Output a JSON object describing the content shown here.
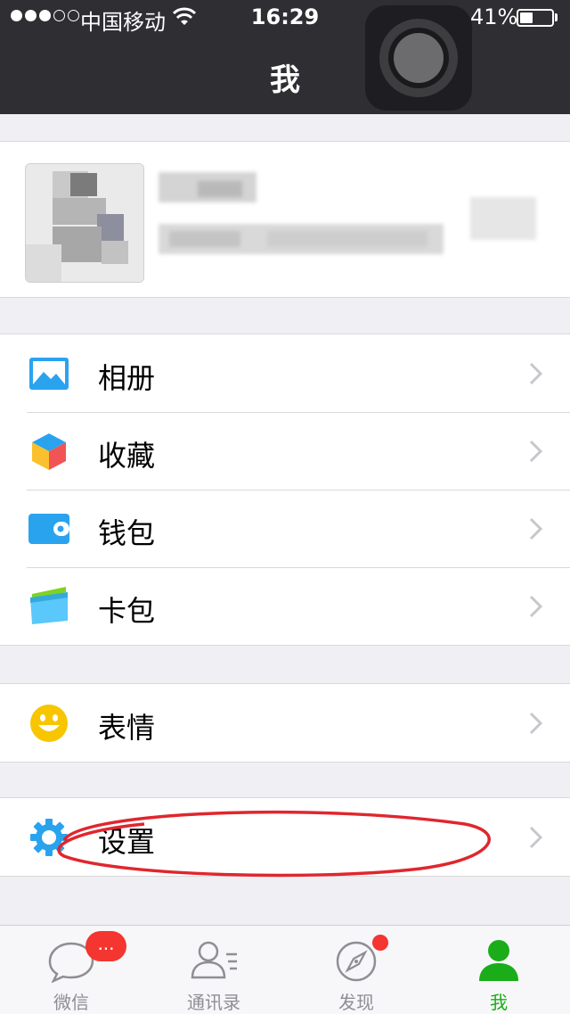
{
  "status_bar": {
    "carrier": "中国移动",
    "time": "16:29",
    "battery_percent": "41%",
    "battery_level": 0.41,
    "signal_bars_filled": 3,
    "signal_bars_total": 5
  },
  "nav": {
    "title": "我"
  },
  "menu_groups": [
    {
      "items": [
        {
          "label": "相册",
          "icon": "album-icon"
        },
        {
          "label": "收藏",
          "icon": "favorites-icon"
        },
        {
          "label": "钱包",
          "icon": "wallet-icon"
        },
        {
          "label": "卡包",
          "icon": "card-package-icon"
        }
      ]
    },
    {
      "items": [
        {
          "label": "表情",
          "icon": "sticker-smile-icon"
        }
      ]
    },
    {
      "items": [
        {
          "label": "设置",
          "icon": "settings-gear-icon"
        }
      ]
    }
  ],
  "tabbar": {
    "tabs": [
      {
        "label": "微信",
        "icon": "chat-bubble-icon",
        "badge": "..."
      },
      {
        "label": "通讯录",
        "icon": "contacts-icon"
      },
      {
        "label": "发现",
        "icon": "compass-icon"
      },
      {
        "label": "我",
        "icon": "me-person-icon",
        "active": true
      }
    ]
  },
  "colors": {
    "accent_green": "#1aad19",
    "badge_red": "#f43530",
    "nav_bg": "#2e2e33",
    "annotation_red": "#e0262e"
  }
}
